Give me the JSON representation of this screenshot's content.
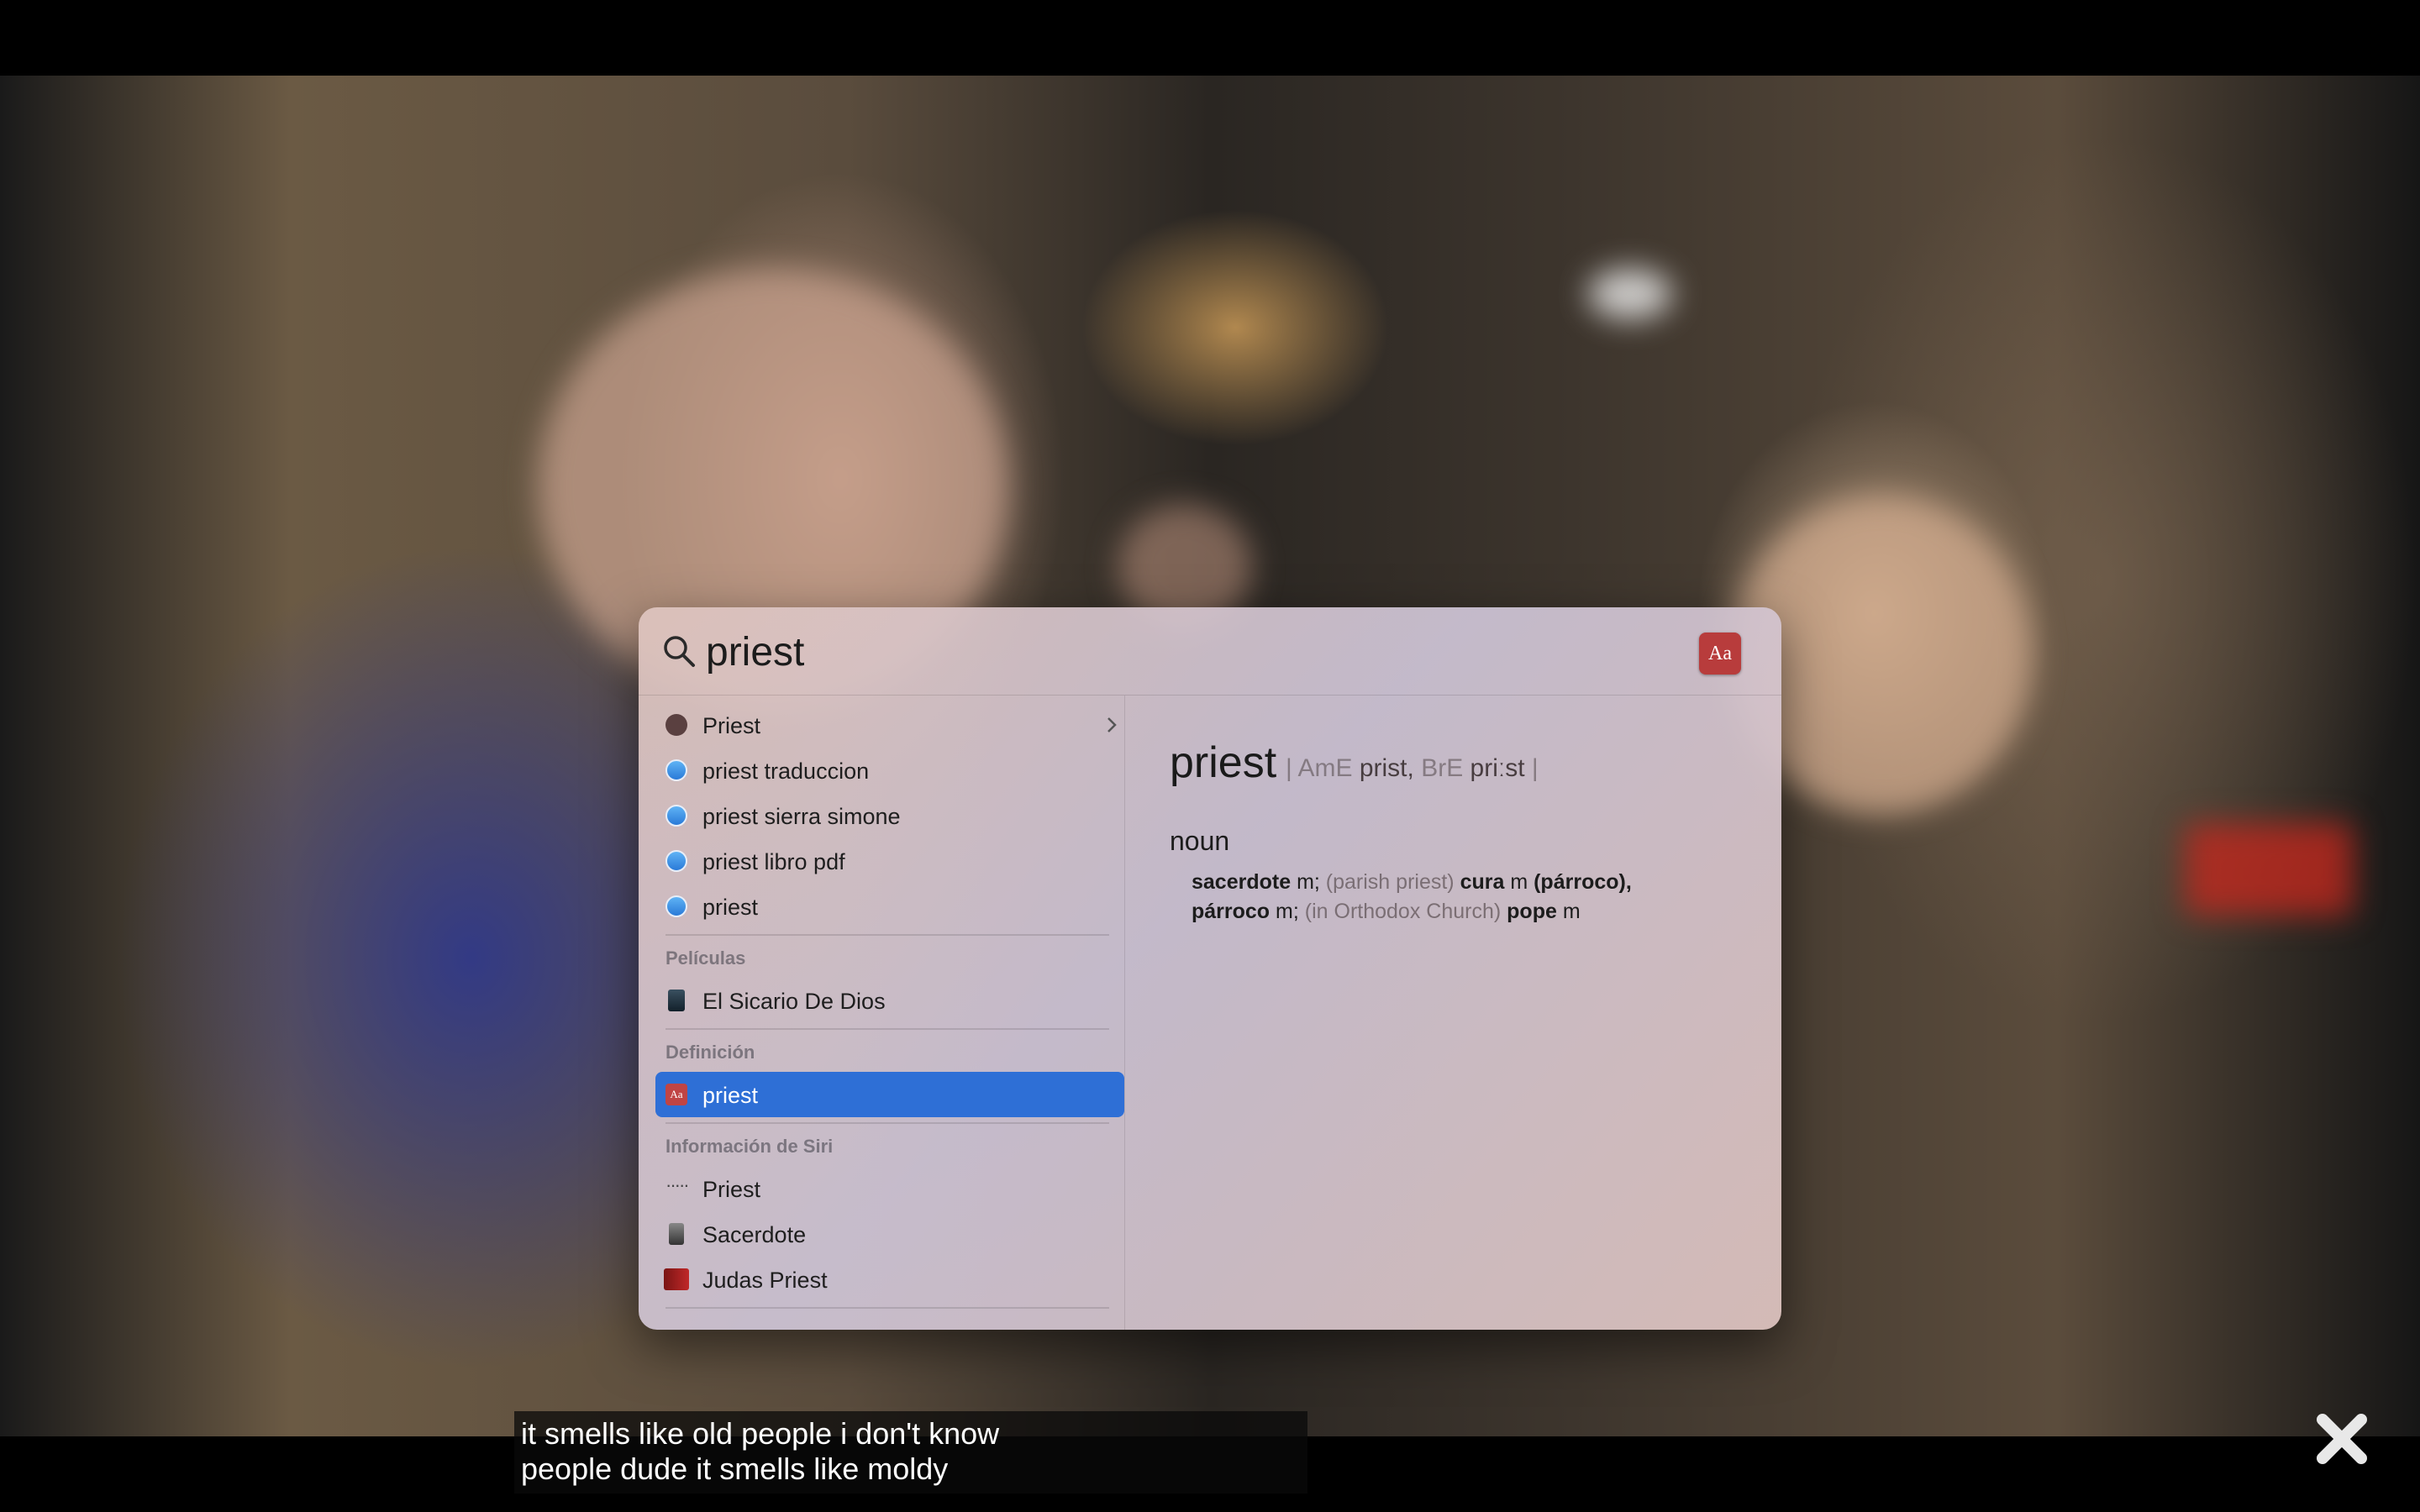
{
  "search": {
    "query": "priest"
  },
  "results": {
    "top_hits": [
      {
        "label": "Priest",
        "icon": "siri-suggestion-icon"
      },
      {
        "label": "priest traduccion",
        "icon": "safari-icon"
      },
      {
        "label": "priest sierra simone",
        "icon": "safari-icon"
      },
      {
        "label": "priest libro pdf",
        "icon": "safari-icon"
      },
      {
        "label": "priest",
        "icon": "safari-icon"
      }
    ],
    "movies": {
      "header": "Películas",
      "items": [
        {
          "label": "El Sicario De Dios",
          "icon": "movie-poster-icon"
        }
      ]
    },
    "definition": {
      "header": "Definición",
      "items": [
        {
          "label": "priest",
          "icon": "dictionary-icon",
          "selected": true
        }
      ]
    },
    "siri": {
      "header": "Información de Siri",
      "items": [
        {
          "label": "Priest",
          "icon": "siri-dots-icon"
        },
        {
          "label": "Sacerdote",
          "icon": "statue-icon"
        },
        {
          "label": "Judas Priest",
          "icon": "band-icon"
        }
      ]
    }
  },
  "dictionary": {
    "app_icon_text": "Aa",
    "word": "priest",
    "pron_open": "| AmE",
    "pron_ame": "prist,",
    "pron_bre_label": "BrE",
    "pron_bre": "priːst",
    "pron_close": "|",
    "part_of_speech": "noun",
    "def_1": "sacerdote",
    "def_1_gender": " m; ",
    "def_2_context": "(parish priest)",
    "def_2": " cura",
    "def_2_gender": " m ",
    "def_2_b": "(párroco),",
    "def_3": "párroco",
    "def_3_gender": " m; ",
    "def_4_context": "(in Orthodox Church)",
    "def_4": " pope",
    "def_4_gender": " m"
  },
  "subtitle": {
    "line1": "it smells like old people i don't know",
    "line2": "people dude it smells like moldy"
  },
  "colors": {
    "selection": "#2e6fd6",
    "dictionary_icon": "#b83c3c"
  }
}
